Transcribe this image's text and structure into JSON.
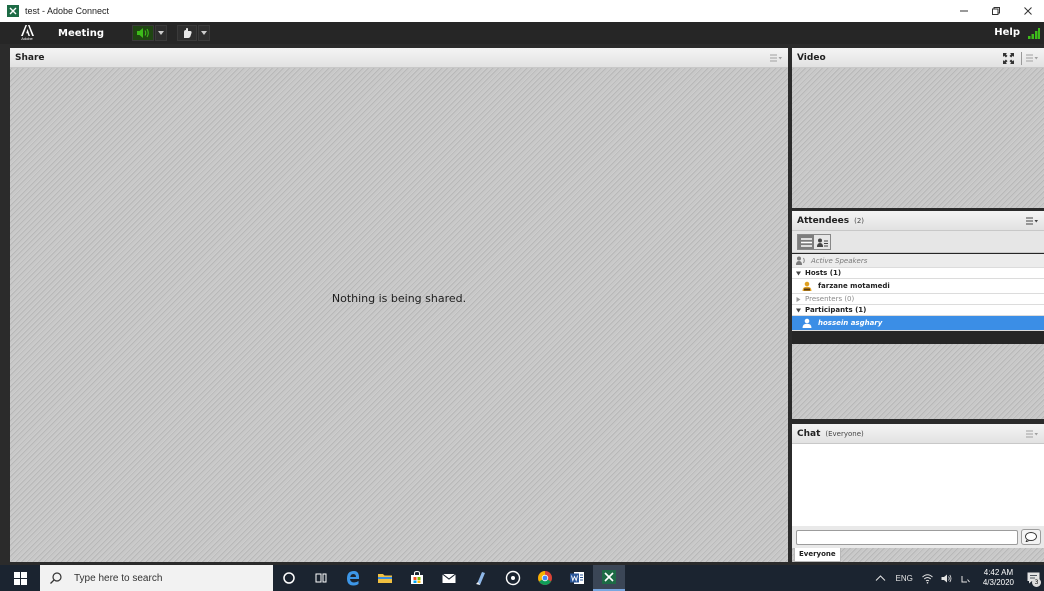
{
  "window": {
    "title": "test - Adobe Connect",
    "icon": "adobe-connect-icon",
    "controls": [
      "minimize-icon",
      "restore-icon",
      "close-icon"
    ]
  },
  "menubar": {
    "logo_text": "Adobe",
    "meeting_label": "Meeting",
    "help_label": "Help",
    "speaker_active_color": "#3dbb1a"
  },
  "share_pod": {
    "title": "Share",
    "empty_message": "Nothing is being shared."
  },
  "video_pod": {
    "title": "Video"
  },
  "attendees_pod": {
    "title": "Attendees",
    "count": "(2)",
    "active_speakers": "Active Speakers",
    "groups": {
      "hosts": "Hosts (1)",
      "presenters": "Presenters (0)",
      "participants": "Participants (1)"
    },
    "hosts": [
      "farzane motamedi"
    ],
    "participants": [
      "hossein asghary"
    ],
    "selected_color": "#3b8ee6"
  },
  "chat_pod": {
    "title": "Chat",
    "scope": "(Everyone)",
    "tab_label": "Everyone",
    "input_value": ""
  },
  "taskbar": {
    "search_placeholder": "Type here to search",
    "time": "4:42 AM",
    "date": "4/3/2020",
    "notifications": "3",
    "tray_lang": "ENG",
    "apps": [
      "cortana-icon",
      "task-view-icon",
      "edge-icon",
      "file-explorer-icon",
      "store-icon",
      "mail-icon",
      "app-icon",
      "media-icon",
      "chrome-icon",
      "word-icon",
      "adobe-connect-taskbar-icon"
    ]
  }
}
